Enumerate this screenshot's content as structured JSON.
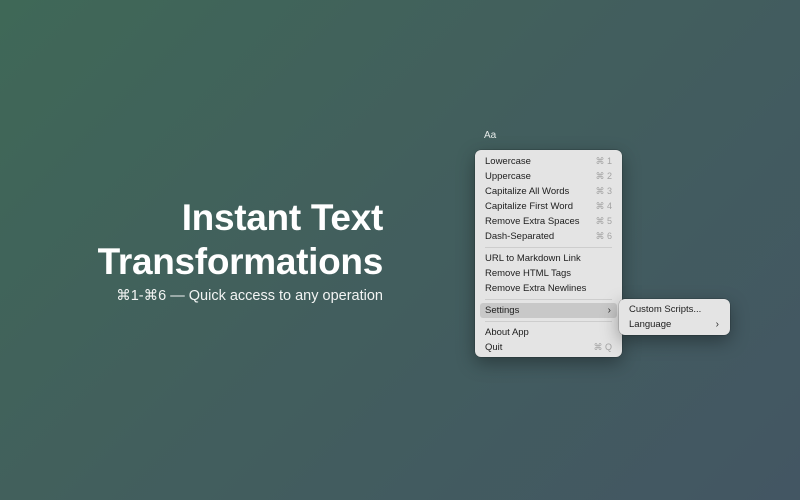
{
  "hero": {
    "title_line1": "Instant Text",
    "title_line2": "Transformations",
    "subtitle": "⌘1-⌘6 — Quick access to any operation"
  },
  "menubar": {
    "title": "Aa"
  },
  "menu": {
    "group1": [
      {
        "label": "Lowercase",
        "shortcut": "⌘ 1"
      },
      {
        "label": "Uppercase",
        "shortcut": "⌘ 2"
      },
      {
        "label": "Capitalize All Words",
        "shortcut": "⌘ 3"
      },
      {
        "label": "Capitalize First Word",
        "shortcut": "⌘ 4"
      },
      {
        "label": "Remove Extra Spaces",
        "shortcut": "⌘ 5"
      },
      {
        "label": "Dash-Separated",
        "shortcut": "⌘ 6"
      }
    ],
    "group2": [
      {
        "label": "URL to Markdown Link"
      },
      {
        "label": "Remove HTML Tags"
      },
      {
        "label": "Remove Extra Newlines"
      }
    ],
    "settings": {
      "label": "Settings",
      "chevron": "›"
    },
    "about": {
      "label": "About App"
    },
    "quit": {
      "label": "Quit",
      "shortcut": "⌘ Q"
    }
  },
  "submenu": {
    "items": [
      {
        "label": "Custom Scripts..."
      },
      {
        "label": "Language",
        "chevron": "›"
      }
    ]
  },
  "colors": {
    "background_start": "#3f6857",
    "background_end": "#435663",
    "menu_bg": "#e4e4e4",
    "highlight": "#c8c8c8"
  }
}
